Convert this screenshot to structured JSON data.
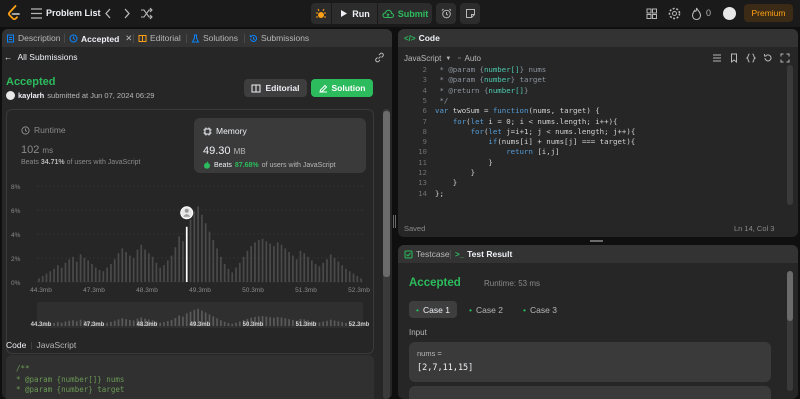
{
  "topbar": {
    "problem_list": "Problem List",
    "run": "Run",
    "submit": "Submit",
    "streak_count": "0",
    "premium": "Premium"
  },
  "left_tabs": {
    "description": "Description",
    "accepted": "Accepted",
    "editorial": "Editorial",
    "solutions": "Solutions",
    "submissions": "Submissions"
  },
  "submission": {
    "back_label": "All Submissions",
    "status": "Accepted",
    "username": "kaylarh",
    "submitted_text": "submitted at Jun 07, 2024 06:29",
    "editorial_btn": "Editorial",
    "solution_btn": "Solution"
  },
  "runtime": {
    "label": "Runtime",
    "value": "102",
    "unit": "ms",
    "beats_prefix": "Beats",
    "beats_pct": "34.71%",
    "beats_suffix": "of users with JavaScript"
  },
  "memory": {
    "label": "Memory",
    "value": "49.30",
    "unit": "MB",
    "beats_prefix": "Beats",
    "beats_pct": "87.68%",
    "beats_suffix": "of users with JavaScript"
  },
  "colors": {
    "accepted": "#2cbb5d",
    "highlight": "#ffa116",
    "bar": "#4a4a4a",
    "bar_selected": "#ffffff"
  },
  "chart_data": {
    "type": "bar",
    "y_ticks": [
      "8%",
      "6%",
      "4%",
      "2%",
      "0%"
    ],
    "x_ticks": [
      "44.3mb",
      "47.3mb",
      "48.3mb",
      "49.3mb",
      "50.3mb",
      "51.3mb",
      "52.3mb"
    ],
    "ylim": [
      0,
      8
    ],
    "selected_index": 39,
    "values": [
      0.3,
      0.5,
      0.7,
      0.9,
      1.1,
      1.4,
      1.2,
      1.6,
      1.9,
      2.1,
      1.7,
      2.3,
      2.0,
      1.8,
      1.5,
      1.2,
      1.0,
      0.9,
      1.2,
      1.5,
      1.9,
      2.4,
      2.8,
      2.5,
      2.2,
      2.0,
      2.7,
      3.1,
      2.7,
      2.4,
      2.1,
      1.6,
      1.2,
      1.4,
      1.8,
      2.2,
      2.9,
      3.8,
      3.4,
      4.6,
      5.2,
      5.9,
      6.3,
      5.6,
      4.9,
      4.2,
      3.5,
      2.8,
      2.1,
      1.5,
      1.1,
      0.8,
      1.2,
      1.6,
      2.1,
      2.6,
      3.0,
      3.3,
      3.5,
      3.6,
      3.4,
      3.2,
      3.0,
      3.3,
      3.1,
      2.8,
      2.5,
      2.2,
      1.9,
      2.6,
      2.4,
      2.1,
      1.8,
      1.5,
      1.3,
      1.6,
      1.9,
      2.3,
      2.0,
      1.7,
      1.4,
      1.1,
      0.9,
      0.7,
      0.5,
      0.3
    ]
  },
  "code_section": {
    "label": "Code",
    "language": "JavaScript",
    "lines": [
      "/**",
      " * @param {number[]} nums",
      " * @param {number} target"
    ]
  },
  "editor": {
    "title": "Code",
    "language": "JavaScript",
    "autocomplete": "Auto",
    "lines": [
      {
        "n": "2",
        "t": " * @param {number[]} nums"
      },
      {
        "n": "3",
        "t": " * @param {number} target"
      },
      {
        "n": "4",
        "t": " * @return {number[]}"
      },
      {
        "n": "5",
        "t": " */"
      },
      {
        "n": "6",
        "t": "var twoSum = function(nums, target) {"
      },
      {
        "n": "7",
        "t": "    for(let i = 0; i < nums.length; i++){"
      },
      {
        "n": "8",
        "t": "        for(let j=i+1; j < nums.length; j++){"
      },
      {
        "n": "9",
        "t": "            if(nums[i] + nums[j] === target){"
      },
      {
        "n": "10",
        "t": "                return [i,j]"
      },
      {
        "n": "11",
        "t": "            }"
      },
      {
        "n": "12",
        "t": "        }"
      },
      {
        "n": "13",
        "t": "    }"
      },
      {
        "n": "14",
        "t": "};"
      }
    ],
    "status_left": "Saved",
    "status_right": "Ln 14, Col 3"
  },
  "result": {
    "testcase_tab": "Testcase",
    "result_tab": "Test Result",
    "status": "Accepted",
    "runtime": "Runtime: 53 ms",
    "cases": [
      "Case 1",
      "Case 2",
      "Case 3"
    ],
    "input_label": "Input",
    "var_name": "nums =",
    "var_value": "[2,7,11,15]"
  }
}
